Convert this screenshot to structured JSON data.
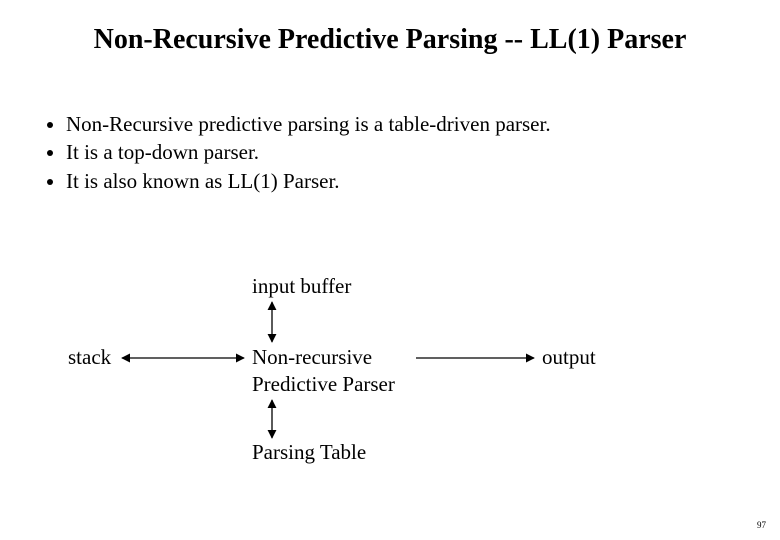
{
  "title": "Non-Recursive Predictive Parsing -- LL(1) Parser",
  "bullets": {
    "b1": "Non-Recursive predictive parsing is a table-driven parser.",
    "b2": "It is a top-down parser.",
    "b3": "It is also known as LL(1) Parser."
  },
  "diagram": {
    "input_buffer": "input buffer",
    "stack": "stack",
    "parser_line1": "Non-recursive",
    "parser_line2": "Predictive Parser",
    "output": "output",
    "parsing_table": "Parsing Table"
  },
  "page_number": "97"
}
